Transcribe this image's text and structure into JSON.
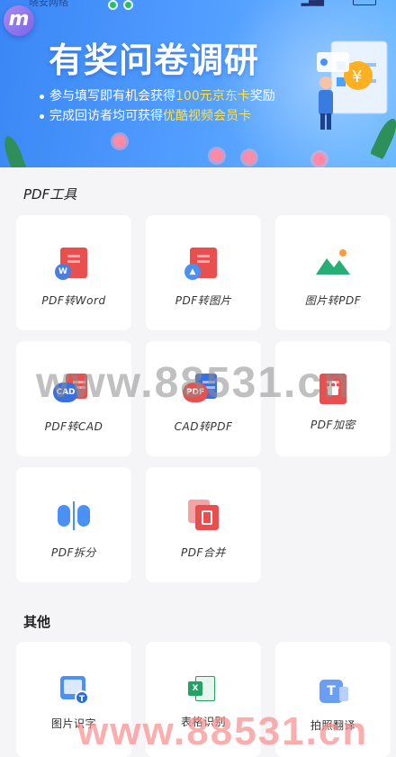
{
  "status_bar": {
    "carrier": "晓安网络"
  },
  "banner": {
    "title": "有奖问卷调研",
    "line1_prefix": "参与填写即有机会获得",
    "line1_highlight": "100元京东卡",
    "line1_suffix": "奖励",
    "line2_prefix": "完成回访者均可获得",
    "line2_highlight": "优酷视频会员卡",
    "illustration_badge": "¥"
  },
  "pdf_tools": {
    "title": "PDF工具",
    "items": [
      {
        "label": "PDF转Word",
        "icon": "pdf-to-word-icon"
      },
      {
        "label": "PDF转图片",
        "icon": "pdf-to-image-icon"
      },
      {
        "label": "图片转PDF",
        "icon": "image-to-pdf-icon"
      },
      {
        "label": "PDF转CAD",
        "icon": "pdf-to-cad-icon"
      },
      {
        "label": "CAD转PDF",
        "icon": "cad-to-pdf-icon"
      },
      {
        "label": "PDF加密",
        "icon": "pdf-encrypt-icon"
      },
      {
        "label": "PDF拆分",
        "icon": "pdf-split-icon"
      },
      {
        "label": "PDF合并",
        "icon": "pdf-merge-icon"
      }
    ]
  },
  "other_tools": {
    "title": "其他",
    "items": [
      {
        "label": "图片识字",
        "icon": "image-ocr-icon"
      },
      {
        "label": "表格识别",
        "icon": "table-recognition-icon"
      },
      {
        "label": "拍照翻译",
        "icon": "photo-translate-icon"
      }
    ]
  },
  "watermark": "www.88531.cn",
  "colors": {
    "accent_blue": "#4a90f5",
    "pdf_red": "#e94f4f",
    "excel_green": "#21a366",
    "highlight_yellow": "#ffe14d"
  }
}
